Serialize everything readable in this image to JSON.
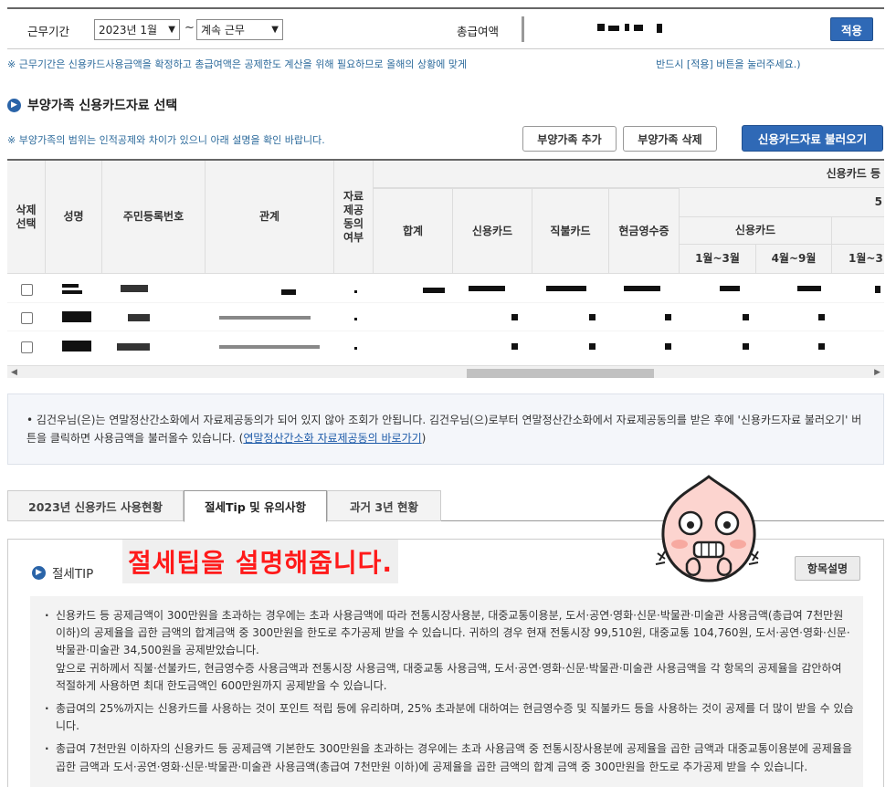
{
  "filter": {
    "period_label": "근무기간",
    "start_value": "2023년 1월",
    "tilde": "~",
    "end_value": "계속 근무",
    "salary_label": "총급여액",
    "apply_button": "적용"
  },
  "notes": {
    "period_note_start": "※ 근무기간은 신용카드사용금액을 확정하고 총급여액은 공제한도 계산을 위해 필요하므로 올해의 상황에 맞게",
    "period_note_end": "반드시 [적용] 버튼을 눌러주세요.)",
    "dependent_note": "※ 부양가족의 범위는 인적공제와 차이가 있으니 아래 설명을 확인 바랍니다."
  },
  "section": {
    "title": "부양가족 신용카드자료 선택",
    "add_button": "부양가족 추가",
    "delete_button": "부양가족 삭제",
    "load_button": "신용카드자료 불러오기"
  },
  "table": {
    "headers": {
      "delete_select": "삭제\n선택",
      "name": "성명",
      "rrn": "주민등록번호",
      "relation": "관계",
      "consent": "자료\n제공\n동의\n여부",
      "group": "신용카드 등",
      "sub_group_partial": "5",
      "total": "합계",
      "credit": "신용카드",
      "debit": "직불카드",
      "cash": "현금영수증",
      "credit_sub": "신용카드",
      "period1": "1월~3월",
      "period2": "4월~9월",
      "period3": "1월~3"
    },
    "rows": [
      {
        "selected": false
      },
      {
        "selected": false
      },
      {
        "selected": false
      }
    ]
  },
  "info": {
    "text": "김건우님(은)는 연말정산간소화에서 자료제공동의가 되어 있지 않아 조회가 안됩니다. 김건우님(으)로부터 연말정산간소화에서 자료제공동의를 받은 후에 '신용카드자료 불러오기' 버튼을 클릭하면 사용금액을 불러올수 있습니다. (",
    "link": "연말정산간소화 자료제공동의 바로가기",
    "text_end": ")"
  },
  "tabs": [
    {
      "label": "2023년 신용카드 사용현황",
      "active": false
    },
    {
      "label": "절세Tip 및 유의사항",
      "active": true
    },
    {
      "label": "과거 3년 현황",
      "active": false
    }
  ],
  "tip": {
    "title": "절세TIP",
    "overlay": "절세팁을 설명해줍니다.",
    "item_button": "항목설명",
    "items": [
      "신용카드 등 공제금액이 300만원을 초과하는 경우에는 초과 사용금액에 따라 전통시장사용분, 대중교통이용분, 도서·공연·영화·신문·박물관·미술관 사용금액(총급여 7천만원 이하)의 공제율을 곱한 금액의 합계금액 중 300만원을 한도로 추가공제 받을 수 있습니다. 귀하의 경우 현재 전통시장 99,510원, 대중교통 104,760원, 도서·공연·영화·신문·박물관·미술관 34,500원을 공제받았습니다.\n앞으로 귀하께서 직불·선불카드, 현금영수증 사용금액과 전통시장 사용금액, 대중교통 사용금액, 도서·공연·영화·신문·박물관·미술관 사용금액을 각 항목의 공제율을 감안하여 적절하게 사용하면 최대 한도금액인 600만원까지 공제받을 수 있습니다.",
      "총급여의 25%까지는 신용카드를 사용하는 것이 포인트 적립 등에 유리하며, 25% 초과분에 대하여는 현금영수증 및 직불카드 등을 사용하는 것이 공제를 더 많이 받을 수 있습니다.",
      "총급여 7천만원 이하자의 신용카드 등 공제금액 기본한도 300만원을 초과하는 경우에는 초과 사용금액 중 전통시장사용분에 공제율을 곱한 금액과 대중교통이용분에 공제율을 곱한 금액과 도서·공연·영화·신문·박물관·미술관 사용금액(총급여 7천만원 이하)에 공제율을 곱한 금액의 합계 금액 중 300만원을 한도로 추가공제 받을 수 있습니다."
    ]
  }
}
